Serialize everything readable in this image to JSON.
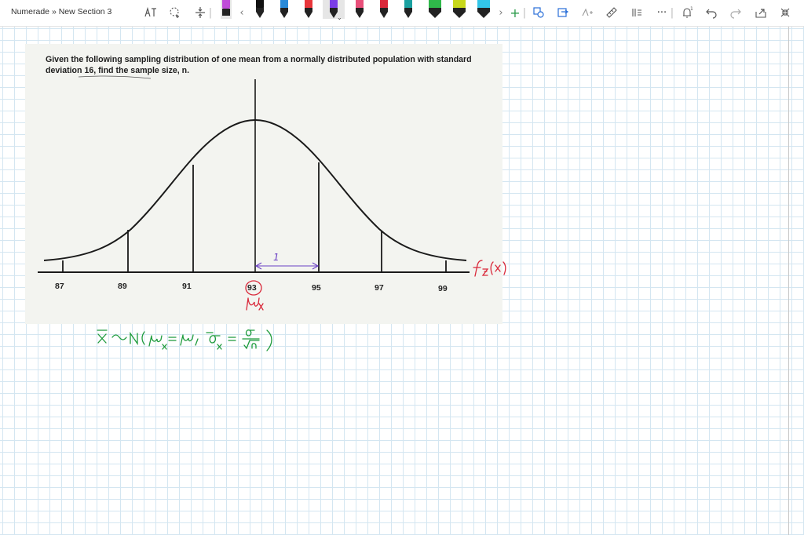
{
  "toolbar": {
    "breadcrumb": "Numerade » New Section 3",
    "pens": [
      {
        "name": "pen-black-selected",
        "color": "#111111"
      },
      {
        "name": "pen-purple",
        "color": "#c04cd8"
      },
      {
        "name": "pen-black-1",
        "color": "#111111"
      },
      {
        "name": "pen-blue",
        "color": "#2a8ad8"
      },
      {
        "name": "pen-red",
        "color": "#e8363b"
      },
      {
        "name": "pen-black-2",
        "color": "#111111"
      },
      {
        "name": "pen-violet",
        "color": "#7b3ee6"
      },
      {
        "name": "pen-pink",
        "color": "#e8507a"
      },
      {
        "name": "pen-crimson",
        "color": "#d9283a"
      },
      {
        "name": "pen-teal",
        "color": "#1aa0a0"
      },
      {
        "name": "pen-green",
        "color": "#2fb84a"
      },
      {
        "name": "pen-lime",
        "color": "#c8d81c"
      },
      {
        "name": "pen-yellow",
        "color": "#f2de25"
      },
      {
        "name": "pen-cyan",
        "color": "#33c5e8"
      }
    ]
  },
  "question": {
    "text": "Given the following sampling distribution of one mean from a normally distributed population with standard deviation 16, find the sample size, n."
  },
  "figure": {
    "tick_labels": [
      "87",
      "89",
      "91",
      "93",
      "95",
      "97",
      "99"
    ],
    "interval_label": "1"
  },
  "colors": {
    "ink_red": "#d9283a",
    "ink_green": "#1e9b3c",
    "ink_purple": "#6a3fc4",
    "grid": "#d4e6f1"
  }
}
